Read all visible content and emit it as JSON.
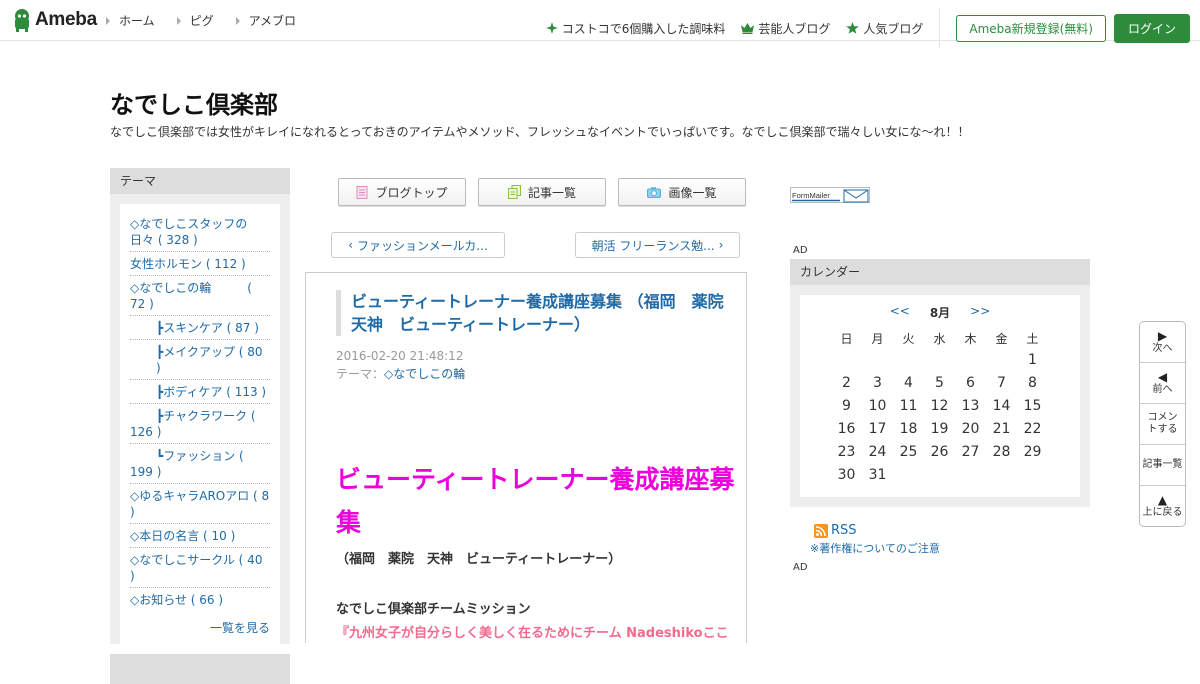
{
  "header": {
    "logo_text": "Ameba",
    "nav": [
      "ホーム",
      "ピグ",
      "アメブロ"
    ],
    "right_links": [
      {
        "label": "コストコで6個購入した調味料",
        "icon": "sparkle-icon"
      },
      {
        "label": "芸能人ブログ",
        "icon": "crown-icon"
      },
      {
        "label": "人気ブログ",
        "icon": "star-icon"
      }
    ],
    "register_label": "Ameba新規登録(無料)",
    "login_label": "ログイン",
    "brand_color": "#2d8c3c"
  },
  "blog": {
    "title": "なでしこ倶楽部",
    "description": "なでしこ倶楽部では女性がキレイになれるとっておきのアイテムやメソッド、フレッシュなイベントでいっぱいです。なでしこ倶楽部で瑞々しい女にな〜れ！！"
  },
  "sidebar": {
    "theme_heading": "テーマ",
    "themes": [
      {
        "label": "◇なでしこスタッフの日々 ( 328 )",
        "indent": false
      },
      {
        "label": "女性ホルモン ( 112 )",
        "indent": false
      },
      {
        "label": "◇なでしこの輪　　　( 72 )",
        "indent": false
      },
      {
        "label": "┣スキンケア ( 87 )",
        "indent": true
      },
      {
        "label": "┣メイクアップ ( 80 )",
        "indent": true
      },
      {
        "label": "┣ボディケア ( 113 )",
        "indent": true
      },
      {
        "label": "┣チャクラワーク ( 126 )",
        "indent": true,
        "wrap_left": true
      },
      {
        "label": "┗ファッション ( 199 )",
        "indent": true,
        "wrap_left": true
      },
      {
        "label": "◇ゆるキャラAROアロ ( 8 )",
        "indent": false
      },
      {
        "label": "◇本日の名言 ( 10 )",
        "indent": false
      },
      {
        "label": "◇なでしこサークル ( 40 )",
        "indent": false
      },
      {
        "label": "◇お知らせ ( 66 )",
        "indent": false
      }
    ],
    "more_label": "一覧を見る"
  },
  "tabs": {
    "blog_top": "ブログトップ",
    "article_list": "記事一覧",
    "image_list": "画像一覧"
  },
  "pagenav": {
    "prev": "ファッションメールカ...",
    "next": "朝活 フリーランス勉..."
  },
  "article": {
    "title": "ビューティートレーナー養成講座募集 （福岡　薬院　天神　ビューティートレーナー）",
    "date": "2016-02-20 21:48:12",
    "theme_prefix": "テーマ：",
    "theme": "◇なでしこの輪",
    "heading": "ビューティートレーナー養成講座募集",
    "subheading": "（福岡　薬院　天神　ビューティートレーナー）",
    "mission": "なでしこ倶楽部チームミッション",
    "pink_line": "『九州女子が自分らしく美しく在るためにチーム Nadeshikoここ"
  },
  "right": {
    "formmailer_label": "FormMailer",
    "ad_label": "AD",
    "calendar": {
      "heading": "カレンダー",
      "prev": "<<",
      "next": ">>",
      "month": "8月",
      "weekdays": [
        "日",
        "月",
        "火",
        "水",
        "木",
        "金",
        "土"
      ],
      "weeks": [
        [
          "",
          "",
          "",
          "",
          "",
          "",
          "1"
        ],
        [
          "2",
          "3",
          "4",
          "5",
          "6",
          "7",
          "8"
        ],
        [
          "9",
          "10",
          "11",
          "12",
          "13",
          "14",
          "15"
        ],
        [
          "16",
          "17",
          "18",
          "19",
          "20",
          "21",
          "22"
        ],
        [
          "23",
          "24",
          "25",
          "26",
          "27",
          "28",
          "29"
        ],
        [
          "30",
          "31",
          "",
          "",
          "",
          "",
          ""
        ]
      ]
    },
    "rss_label": "RSS",
    "copyright_label": "※著作権についてのご注意",
    "ad2_label": "AD"
  },
  "floatnav": {
    "next": "次へ",
    "prev": "前へ",
    "comment": "コメントする",
    "list": "記事一覧",
    "top": "上に戻る"
  }
}
